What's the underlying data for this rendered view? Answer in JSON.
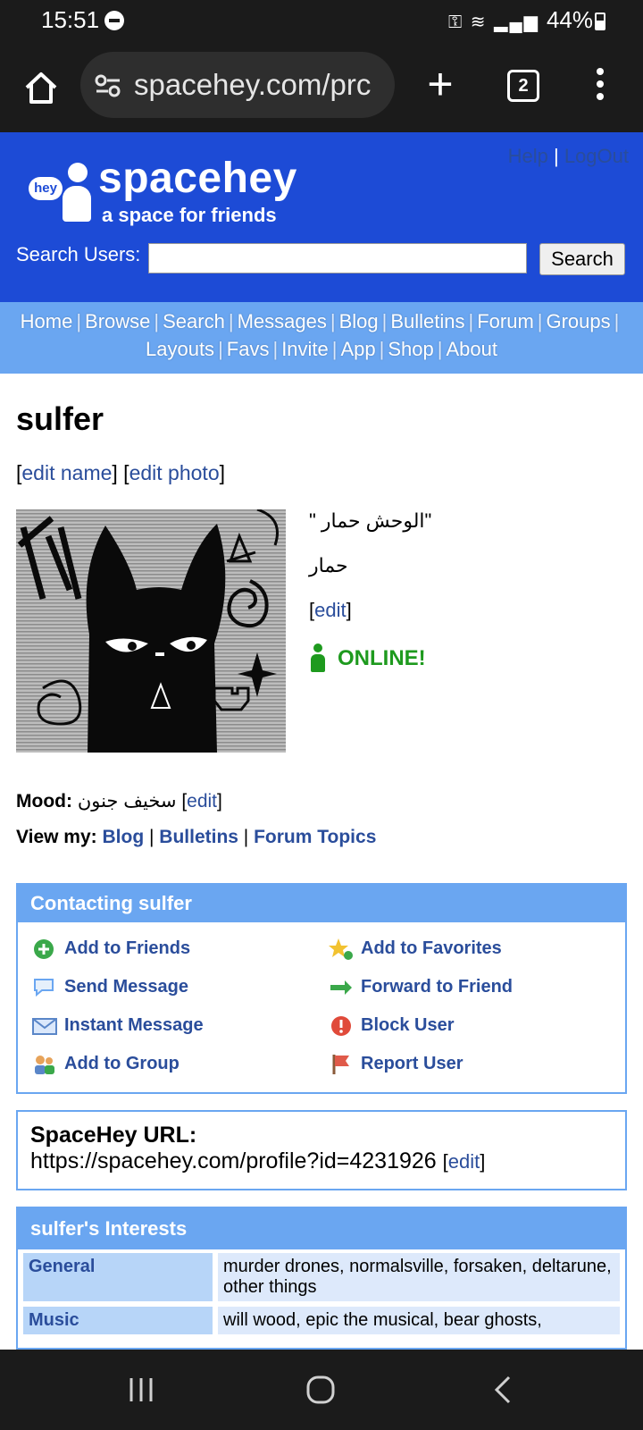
{
  "status_bar": {
    "time": "15:51",
    "battery": "44%"
  },
  "browser": {
    "url": "spacehey.com/prc",
    "tab_count": "2"
  },
  "header": {
    "help": "Help",
    "logout": "LogOut",
    "brand": "spacehey",
    "tagline": "a space for friends",
    "logo_bubble": "hey",
    "search_label": "Search Users:",
    "search_button": "Search"
  },
  "nav": [
    "Home",
    "Browse",
    "Search",
    "Messages",
    "Blog",
    "Bulletins",
    "Forum",
    "Groups",
    "Layouts",
    "Favs",
    "Invite",
    "App",
    "Shop",
    "About"
  ],
  "profile": {
    "name": "sulfer",
    "edit_name": "edit name",
    "edit_photo": "edit photo",
    "headline": "\" الوحش حمار\"",
    "subline": "حمار",
    "edit": "edit",
    "online": "ONLINE!",
    "mood_label": "Mood:",
    "mood_value": "سخيف جنون",
    "mood_edit": "edit",
    "viewmy_label": "View my:",
    "viewmy_links": [
      "Blog",
      "Bulletins",
      "Forum Topics"
    ]
  },
  "contacting": {
    "title": "Contacting sulfer",
    "items": [
      {
        "label": "Add to Friends",
        "icon": "add-friend-icon"
      },
      {
        "label": "Add to Favorites",
        "icon": "favorite-star-icon"
      },
      {
        "label": "Send Message",
        "icon": "speech-bubble-icon"
      },
      {
        "label": "Forward to Friend",
        "icon": "arrow-right-icon"
      },
      {
        "label": "Instant Message",
        "icon": "envelope-icon"
      },
      {
        "label": "Block User",
        "icon": "block-icon"
      },
      {
        "label": "Add to Group",
        "icon": "group-icon"
      },
      {
        "label": "Report User",
        "icon": "flag-icon"
      }
    ]
  },
  "spacehey_url": {
    "title": "SpaceHey URL:",
    "url": "https://spacehey.com/profile?id=4231926",
    "edit": "edit"
  },
  "interests": {
    "title": "sulfer's Interests",
    "rows": [
      {
        "key": "General",
        "value": "murder drones, normalsville, forsaken, deltarune, other things"
      },
      {
        "key": "Music",
        "value": "will wood, epic the musical, bear ghosts,"
      }
    ]
  },
  "colors": {
    "header_blue": "#1d4bd6",
    "nav_blue": "#6aa6f1",
    "link": "#2a4d9b",
    "online_green": "#1e9a1e"
  }
}
